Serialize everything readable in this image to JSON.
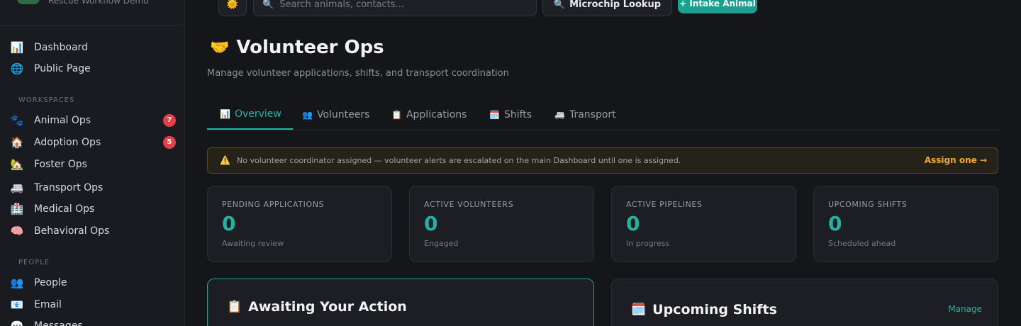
{
  "brand": {
    "subtitle": "Rescue Workflow Demo"
  },
  "sidebar": {
    "items_top": [
      {
        "icon": "📊",
        "label": "Dashboard"
      },
      {
        "icon": "🌐",
        "label": "Public Page"
      }
    ],
    "workspaces_heading": "WORKSPACES",
    "workspaces": [
      {
        "icon": "🐾",
        "label": "Animal Ops",
        "badge": "7"
      },
      {
        "icon": "🏠",
        "label": "Adoption Ops",
        "badge": "5"
      },
      {
        "icon": "🏡",
        "label": "Foster Ops"
      },
      {
        "icon": "🚐",
        "label": "Transport Ops"
      },
      {
        "icon": "🏥",
        "label": "Medical Ops"
      },
      {
        "icon": "🧠",
        "label": "Behavioral Ops"
      }
    ],
    "people_heading": "PEOPLE",
    "people": [
      {
        "icon": "👥",
        "label": "People"
      },
      {
        "icon": "📧",
        "label": "Email"
      },
      {
        "icon": "💬",
        "label": "Messages"
      }
    ]
  },
  "topbar": {
    "sun_icon": "🌞",
    "search_icon": "🔍",
    "search_placeholder": "Search animals, contacts...",
    "microchip_icon": "🔍",
    "microchip_label": "Microchip Lookup",
    "intake_label": "+ Intake Animal"
  },
  "page": {
    "title_icon": "🤝",
    "title": "Volunteer Ops",
    "subtitle": "Manage volunteer applications, shifts, and transport coordination"
  },
  "tabs": [
    {
      "icon": "📊",
      "label": "Overview",
      "active": true
    },
    {
      "icon": "👥",
      "label": "Volunteers"
    },
    {
      "icon": "📋",
      "label": "Applications"
    },
    {
      "icon": "🗓️",
      "label": "Shifts"
    },
    {
      "icon": "🚐",
      "label": "Transport"
    }
  ],
  "alert": {
    "icon": "⚠️",
    "text": "No volunteer coordinator assigned — volunteer alerts are escalated on the main Dashboard until one is assigned.",
    "link": "Assign one →"
  },
  "stats": [
    {
      "label": "PENDING APPLICATIONS",
      "value": "0",
      "note": "Awaiting review"
    },
    {
      "label": "ACTIVE VOLUNTEERS",
      "value": "0",
      "note": "Engaged"
    },
    {
      "label": "ACTIVE PIPELINES",
      "value": "0",
      "note": "In progress"
    },
    {
      "label": "UPCOMING SHIFTS",
      "value": "0",
      "note": "Scheduled ahead"
    }
  ],
  "panels": {
    "awaiting": {
      "icon": "📋",
      "title": "Awaiting Your Action"
    },
    "shifts": {
      "icon": "🗓️",
      "title": "Upcoming Shifts",
      "link": "Manage"
    }
  },
  "colors": {
    "accent": "#21b3a1",
    "badge": "#e53e4a",
    "warning": "#f0a92a"
  }
}
